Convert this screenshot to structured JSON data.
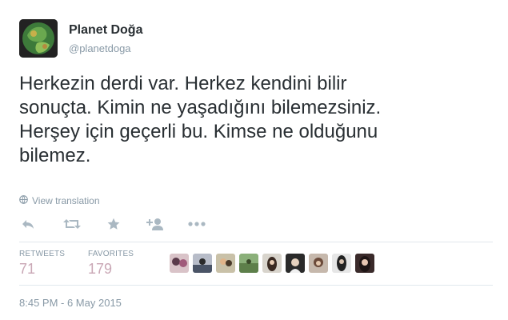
{
  "user": {
    "display_name": "Planet Doğa",
    "screen_name": "@planetdoga"
  },
  "tweet": {
    "text_lines": [
      "Herkezin derdi var. Herkez kendini bilir",
      "sonuçta. Kimin ne yaşadığını bilemezsiniz.",
      "Herşey için geçerli bu. Kimse ne olduğunu",
      "bilemez."
    ],
    "translate_label": "View translation"
  },
  "actions": [
    "reply-icon",
    "retweet-icon",
    "favorite-star-icon",
    "follow-icon",
    "more-icon"
  ],
  "stats": {
    "retweets_label": "RETWEETS",
    "retweets_value": "71",
    "favorites_label": "FAVORITES",
    "favorites_value": "179"
  },
  "favoriter_count_shown": 10,
  "timestamp": "8:45 PM - 6 May 2015",
  "colors": {
    "text": "#292f33",
    "muted": "#8899a6",
    "stat_value": "#c9a7b5",
    "divider": "#e1e8ed"
  }
}
